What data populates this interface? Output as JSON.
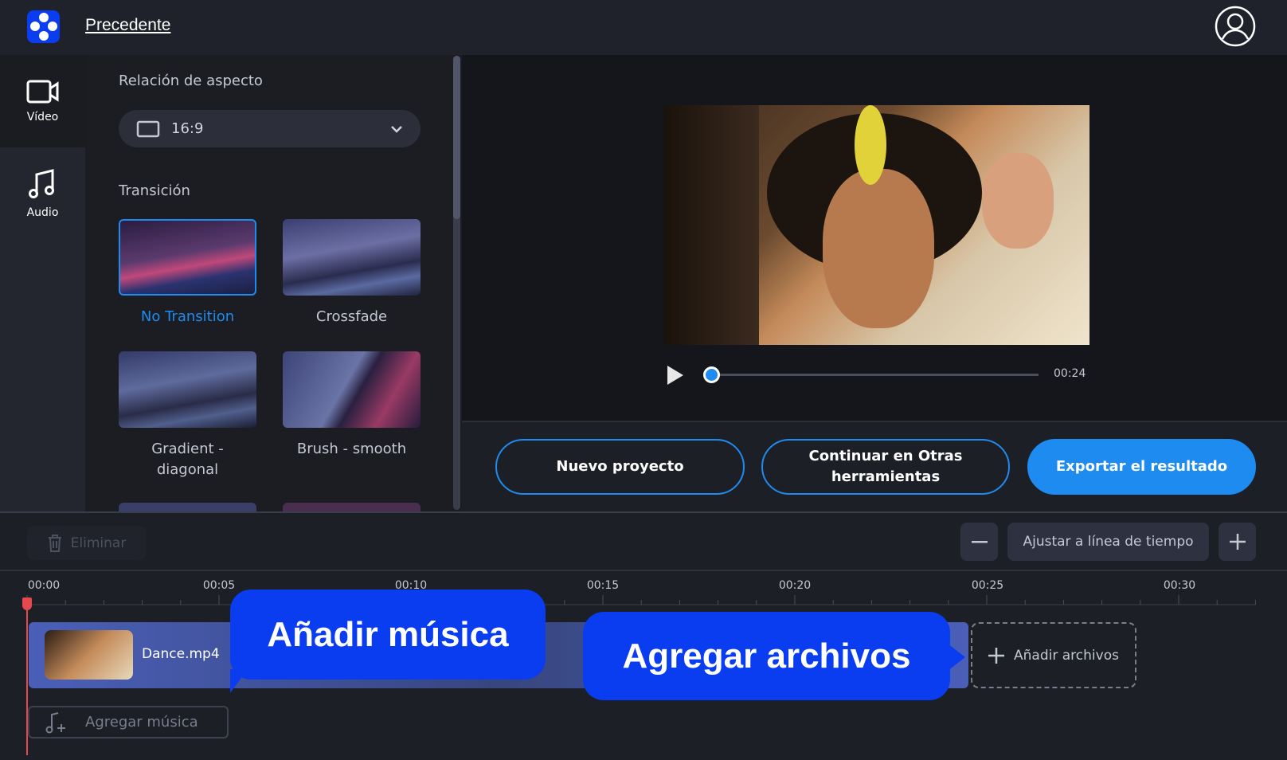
{
  "header": {
    "back_link": "Precedente"
  },
  "nav": {
    "items": [
      {
        "label": "Vídeo",
        "icon": "video-camera-icon"
      },
      {
        "label": "Audio",
        "icon": "music-note-icon"
      }
    ]
  },
  "panel": {
    "aspect_label": "Relación de aspecto",
    "aspect_value": "16:9",
    "transition_label": "Transición",
    "transitions": [
      {
        "label": "No Transition",
        "selected": true
      },
      {
        "label": "Crossfade"
      },
      {
        "label": "Gradient - diagonal"
      },
      {
        "label": "Brush - smooth"
      }
    ]
  },
  "player": {
    "duration": "00:24",
    "progress": 0
  },
  "actions": {
    "new_project": "Nuevo proyecto",
    "continue": "Continuar en Otras herramientas",
    "export": "Exportar el resultado"
  },
  "timeline": {
    "delete": "Eliminar",
    "fit": "Ajustar a línea de tiempo",
    "ruler": [
      "00:00",
      "00:05",
      "00:10",
      "00:15",
      "00:20",
      "00:25",
      "00:30"
    ],
    "clip_name": "Dance.mp4",
    "add_files": "Añadir archivos",
    "add_music": "Agregar música"
  },
  "callouts": {
    "music": "Añadir música",
    "files": "Agregar archivos"
  },
  "colors": {
    "accent": "#1e8bf0",
    "brand": "#0a3cf0",
    "playhead": "#e5484d"
  }
}
